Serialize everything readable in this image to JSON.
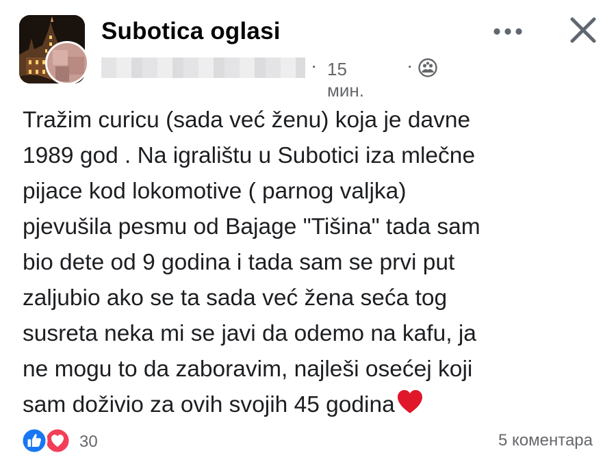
{
  "header": {
    "group_name": "Subotica oglasi",
    "time": "15 мин.",
    "separator": "·",
    "icons": {
      "more": "more-options-icon",
      "close": "close-icon",
      "audience": "group-members-icon"
    }
  },
  "post": {
    "text": "Tražim curicu (sada već ženu) koja je davne\n1989 god . Na igralištu u Subotici iza mlečne\npijace kod lokomotive ( parnog valjka)\npjevušila pesmu od Bajage \"Tišina\" tada sam\nbio dete od 9 godina i tada sam se prvi put\nzaljubio ako se ta sada već žena seća tog\nsusreta neka mi se javi da odemo na kafu, ja\nne mogu to da zaboravim, najleši osećej koji\nsam doživio za ovih svojih 45 godina",
    "emoji": "heart-emoji"
  },
  "footer": {
    "reaction_count": "30",
    "comments": "5 коментара",
    "reaction_icons": [
      "like-icon",
      "love-icon"
    ]
  },
  "colors": {
    "like": "#1877f2",
    "love": "#f33e58",
    "meta_text": "#65676b",
    "heart": "#e0162b"
  }
}
